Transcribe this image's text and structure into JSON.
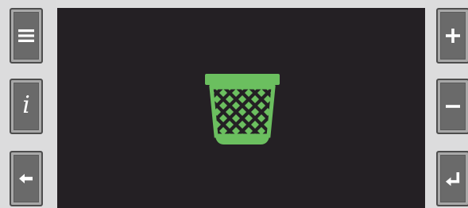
{
  "buttons": {
    "menu": {
      "icon": "hamburger-menu-icon"
    },
    "info": {
      "icon": "info-icon",
      "glyph": "i"
    },
    "back": {
      "icon": "arrow-left-icon"
    },
    "plus": {
      "icon": "plus-icon"
    },
    "minus": {
      "icon": "minus-icon"
    },
    "enter": {
      "icon": "enter-return-icon"
    }
  },
  "screen": {
    "icon": "trash-icon",
    "icon_color": "#6bbf5f",
    "background": "#242024"
  }
}
